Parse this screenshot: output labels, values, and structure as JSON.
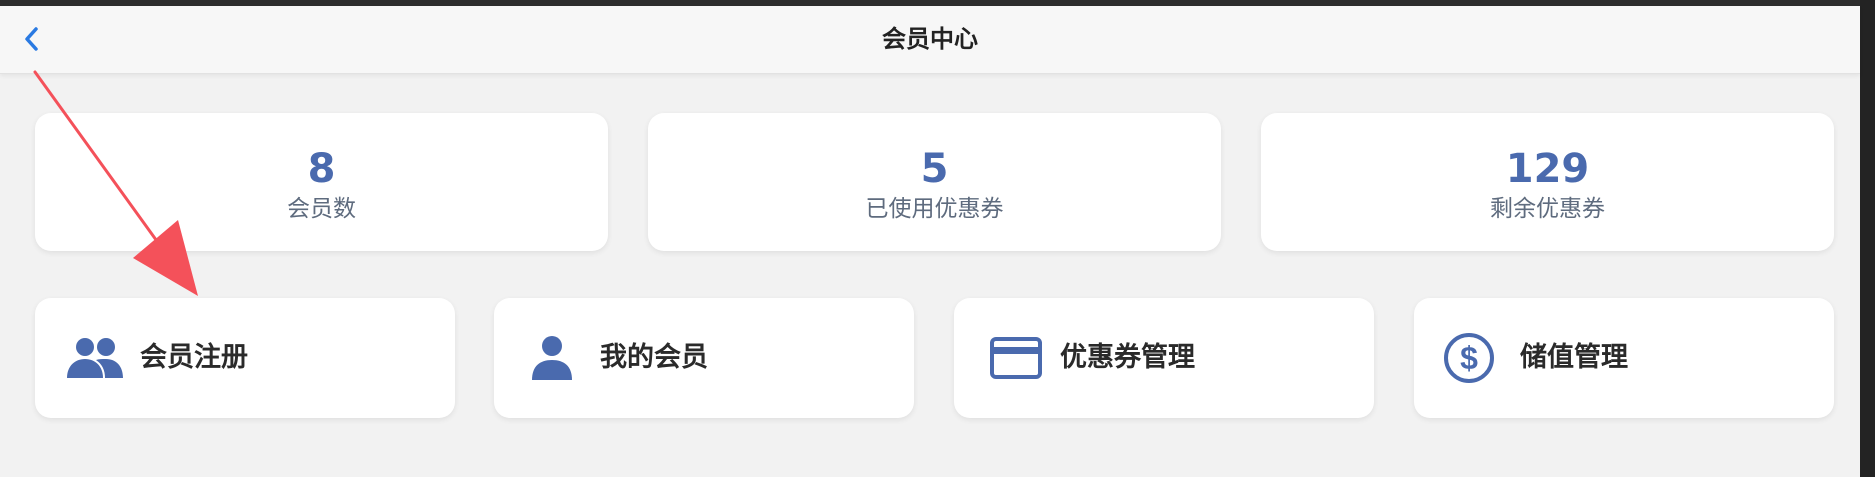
{
  "navbar": {
    "title": "会员中心",
    "back_icon": "chevron-left-icon"
  },
  "stats": [
    {
      "value": "8",
      "label": "会员数"
    },
    {
      "value": "5",
      "label": "已使用优惠券"
    },
    {
      "value": "129",
      "label": "剩余优惠券"
    }
  ],
  "actions": [
    {
      "label": "会员注册",
      "icon": "group-icon"
    },
    {
      "label": "我的会员",
      "icon": "person-icon"
    },
    {
      "label": "优惠券管理",
      "icon": "credit-card-icon"
    },
    {
      "label": "储值管理",
      "icon": "dollar-circle-icon"
    }
  ],
  "colors": {
    "accent": "#4a6aae",
    "back_icon": "#2a7ae2",
    "annotation_arrow": "#f4515a",
    "background": "#f2f2f2",
    "card": "#ffffff"
  }
}
